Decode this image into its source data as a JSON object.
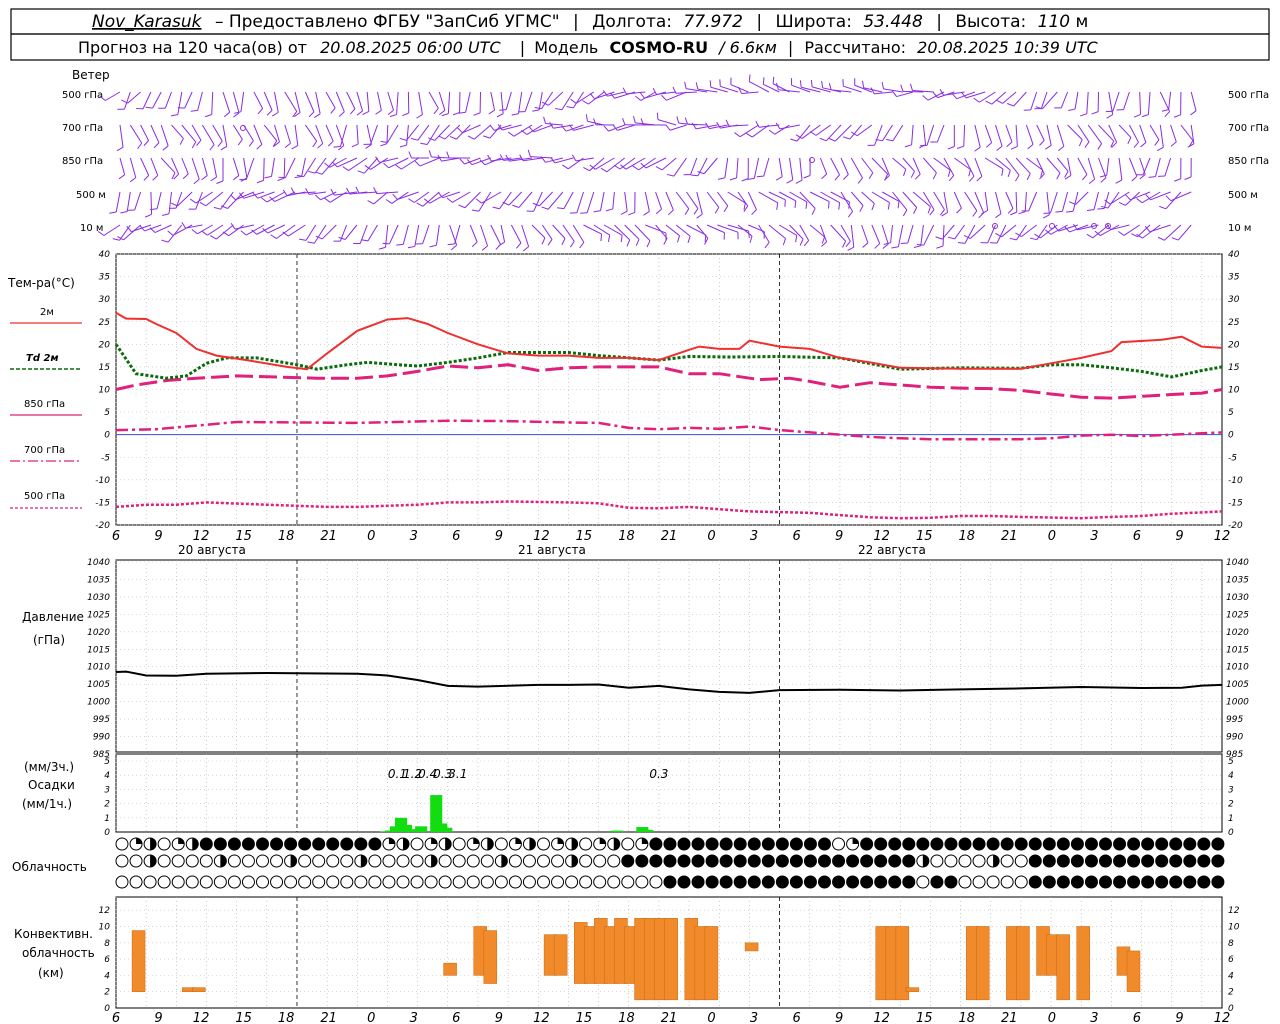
{
  "header": {
    "station": "Nov_Karasuk",
    "provided": "– Предоставлено ФГБУ \"ЗапСиб УГМС\"",
    "lon_label": "Долгота:",
    "lon": "77.972",
    "lat_label": "Широта:",
    "lat": "53.448",
    "alt_label": "Высота:",
    "alt": "110",
    "alt_unit": "м",
    "forecast_prefix": "Прогноз на 120 часа(ов) от",
    "forecast_time": "20.08.2025 06:00 UTC",
    "model_label": "Модель",
    "model_name": "COSMO-RU",
    "model_res": "/ 6.6км",
    "calc_label": "Рассчитано:",
    "calc_time": "20.08.2025 10:39 UTC"
  },
  "colors": {
    "t2m": "#ee3030",
    "td2m": "#0a6b0a",
    "t850": "#e0207a",
    "t700": "#e0207a",
    "t500": "#e0207a",
    "zero_line": "#3050e0",
    "wind": "#8a2be2",
    "precip": "#11dd11",
    "conv": "#f08a2a",
    "pressure": "#000000"
  },
  "axes": {
    "hour_ticks": [
      "6",
      "9",
      "12",
      "15",
      "18",
      "21",
      "0",
      "3",
      "6",
      "9",
      "12",
      "15",
      "18",
      "21",
      "0",
      "3",
      "6",
      "9",
      "12",
      "15",
      "18",
      "21",
      "0",
      "3",
      "6",
      "9",
      "12"
    ],
    "dates": [
      "20 августа",
      "21 августа",
      "22 августа"
    ],
    "temp_ticks": [
      "40",
      "35",
      "30",
      "25",
      "20",
      "15",
      "10",
      "5",
      "0",
      "-5",
      "-10",
      "-15",
      "-20"
    ],
    "pres_ticks": [
      "1040",
      "1035",
      "1030",
      "1025",
      "1020",
      "1015",
      "1010",
      "1005",
      "1000",
      "995",
      "990",
      "985"
    ],
    "precip_ticks": [
      "5",
      "4",
      "3",
      "2",
      "1",
      "0"
    ],
    "conv_ticks": [
      "12",
      "10",
      "8",
      "6",
      "4",
      "2",
      "0"
    ]
  },
  "panels": {
    "wind_title": "Ветер",
    "wind_levels": [
      "500 гПа",
      "700 гПа",
      "850 гПа",
      "500 м",
      "10 м"
    ],
    "temp_title": "Тем-ра(°C)",
    "temp_legend": [
      "2м",
      "Td 2м",
      "850 гПа",
      "700 гПа",
      "500 гПа"
    ],
    "pres_title_1": "Давление",
    "pres_title_2": "(гПа)",
    "precip_title_1": "(мм/3ч.)",
    "precip_title_2": "Осадки",
    "precip_title_3": "(мм/1ч.)",
    "cloud_title": "Облачность",
    "conv_title_1": "Конвективн.",
    "conv_title_2": "облачность",
    "conv_title_3": "(км)"
  },
  "chart_data": {
    "type": "line",
    "x_hours_from_start": "0..30 (20.08 06 UTC — 22.08 12 UTC)",
    "t2m": [
      [
        0,
        27
      ],
      [
        1,
        25.7
      ],
      [
        3,
        25.6
      ],
      [
        4,
        24.5
      ],
      [
        6,
        22.5
      ],
      [
        8,
        19
      ],
      [
        10,
        17.5
      ],
      [
        13,
        16.5
      ],
      [
        17,
        15
      ],
      [
        19,
        14.5
      ],
      [
        21,
        18
      ],
      [
        24,
        23
      ],
      [
        27,
        25.5
      ],
      [
        29,
        25.8
      ],
      [
        31,
        24.5
      ],
      [
        33,
        22.5
      ],
      [
        36,
        20
      ],
      [
        39,
        18
      ],
      [
        42,
        17.5
      ],
      [
        45,
        17.5
      ],
      [
        48,
        17
      ],
      [
        51,
        17
      ],
      [
        54,
        16.5
      ],
      [
        57,
        18.8
      ],
      [
        58,
        19.5
      ],
      [
        60,
        19
      ],
      [
        62,
        19
      ],
      [
        63,
        20.8
      ],
      [
        66,
        19.5
      ],
      [
        69,
        19
      ],
      [
        72,
        17
      ],
      [
        75,
        16
      ],
      [
        78,
        14.8
      ],
      [
        84,
        14.6
      ],
      [
        90,
        14.6
      ],
      [
        93,
        15.8
      ],
      [
        96,
        17
      ],
      [
        99,
        18.5
      ],
      [
        100,
        20.5
      ],
      [
        104,
        21
      ],
      [
        106,
        21.7
      ],
      [
        108,
        19.5
      ],
      [
        110,
        19.2
      ]
    ],
    "td2m": [
      [
        0,
        20
      ],
      [
        2,
        13.5
      ],
      [
        5,
        12.5
      ],
      [
        7,
        13
      ],
      [
        9,
        15.8
      ],
      [
        11,
        17
      ],
      [
        14,
        17
      ],
      [
        18,
        15.5
      ],
      [
        20,
        14.5
      ],
      [
        23,
        15.5
      ],
      [
        25,
        16
      ],
      [
        28,
        15.5
      ],
      [
        30,
        15.2
      ],
      [
        33,
        16
      ],
      [
        36,
        17
      ],
      [
        39,
        18.2
      ],
      [
        45,
        18.2
      ],
      [
        48,
        17.5
      ],
      [
        54,
        16.5
      ],
      [
        57,
        17.3
      ],
      [
        61,
        17.2
      ],
      [
        66,
        17.3
      ],
      [
        72,
        17
      ],
      [
        78,
        14.5
      ],
      [
        84,
        14.8
      ],
      [
        90,
        14.7
      ],
      [
        93,
        15.5
      ],
      [
        96,
        15.5
      ],
      [
        99,
        14.8
      ],
      [
        102,
        14
      ],
      [
        105,
        12.8
      ],
      [
        108,
        14.2
      ],
      [
        110,
        15
      ]
    ],
    "t850": [
      [
        0,
        10
      ],
      [
        2,
        11
      ],
      [
        5,
        12
      ],
      [
        8,
        12.5
      ],
      [
        12,
        13
      ],
      [
        20,
        12.5
      ],
      [
        24,
        12.5
      ],
      [
        27,
        13
      ],
      [
        30,
        14
      ],
      [
        33,
        15.2
      ],
      [
        36,
        14.8
      ],
      [
        39,
        15.5
      ],
      [
        42,
        14.2
      ],
      [
        45,
        14.8
      ],
      [
        48,
        15
      ],
      [
        54,
        15
      ],
      [
        57,
        13.5
      ],
      [
        60,
        13.5
      ],
      [
        64,
        12.2
      ],
      [
        67,
        12.5
      ],
      [
        69,
        11.8
      ],
      [
        72,
        10.5
      ],
      [
        75,
        11.5
      ],
      [
        78,
        11
      ],
      [
        81,
        10.5
      ],
      [
        84,
        10.3
      ],
      [
        87,
        10.2
      ],
      [
        90,
        9.8
      ],
      [
        93,
        9
      ],
      [
        96,
        8.3
      ],
      [
        99,
        8.1
      ],
      [
        102,
        8.5
      ],
      [
        105,
        8.9
      ],
      [
        108,
        9.2
      ],
      [
        110,
        10
      ]
    ],
    "t700": [
      [
        0,
        1
      ],
      [
        4,
        1.2
      ],
      [
        8,
        2
      ],
      [
        12,
        2.8
      ],
      [
        24,
        2.6
      ],
      [
        28,
        2.8
      ],
      [
        33,
        3.1
      ],
      [
        39,
        3
      ],
      [
        45,
        2.7
      ],
      [
        48,
        2.6
      ],
      [
        51,
        1.5
      ],
      [
        54,
        1.2
      ],
      [
        57,
        1.5
      ],
      [
        60,
        1.3
      ],
      [
        63,
        1.8
      ],
      [
        66,
        1
      ],
      [
        69,
        0.5
      ],
      [
        72,
        0
      ],
      [
        75,
        -0.5
      ],
      [
        78,
        -0.8
      ],
      [
        81,
        -1
      ],
      [
        84,
        -1
      ],
      [
        90,
        -1
      ],
      [
        93,
        -0.8
      ],
      [
        96,
        -0.2
      ],
      [
        99,
        0
      ],
      [
        102,
        -0.3
      ],
      [
        105,
        0
      ],
      [
        108,
        0.3
      ],
      [
        110,
        0.5
      ]
    ],
    "t500": [
      [
        0,
        -16
      ],
      [
        3,
        -15.5
      ],
      [
        6,
        -15.5
      ],
      [
        9,
        -15
      ],
      [
        15,
        -15.5
      ],
      [
        21,
        -16
      ],
      [
        24,
        -16
      ],
      [
        30,
        -15.5
      ],
      [
        33,
        -15
      ],
      [
        36,
        -15
      ],
      [
        39,
        -14.8
      ],
      [
        45,
        -15
      ],
      [
        48,
        -15.2
      ],
      [
        51,
        -16.2
      ],
      [
        54,
        -16.3
      ],
      [
        57,
        -16
      ],
      [
        60,
        -16.5
      ],
      [
        63,
        -17
      ],
      [
        69,
        -17.3
      ],
      [
        72,
        -17.8
      ],
      [
        75,
        -18.3
      ],
      [
        78,
        -18.5
      ],
      [
        81,
        -18.4
      ],
      [
        84,
        -18
      ],
      [
        87,
        -18
      ],
      [
        90,
        -18.2
      ],
      [
        96,
        -18.5
      ],
      [
        99,
        -18.2
      ],
      [
        102,
        -18
      ],
      [
        105,
        -17.5
      ],
      [
        108,
        -17.2
      ],
      [
        110,
        -17
      ]
    ],
    "pressure": [
      [
        0,
        1008.5
      ],
      [
        1,
        1008.6
      ],
      [
        3,
        1007.5
      ],
      [
        6,
        1007.4
      ],
      [
        9,
        1008
      ],
      [
        15,
        1008.2
      ],
      [
        24,
        1008
      ],
      [
        27,
        1007.5
      ],
      [
        30,
        1006.2
      ],
      [
        33,
        1004.5
      ],
      [
        36,
        1004.3
      ],
      [
        42,
        1004.8
      ],
      [
        45,
        1004.8
      ],
      [
        48,
        1004.9
      ],
      [
        51,
        1004
      ],
      [
        54,
        1004.5
      ],
      [
        57,
        1003.5
      ],
      [
        60,
        1002.8
      ],
      [
        63,
        1002.5
      ],
      [
        66,
        1003.3
      ],
      [
        72,
        1003.4
      ],
      [
        78,
        1003.2
      ],
      [
        84,
        1003.5
      ],
      [
        90,
        1003.8
      ],
      [
        96,
        1004.2
      ],
      [
        102,
        1003.9
      ],
      [
        106,
        1004
      ],
      [
        108,
        1004.6
      ],
      [
        110,
        1004.8
      ]
    ],
    "precip_labels": [
      [
        "0.1",
        54
      ],
      [
        "1.2",
        57
      ],
      [
        "0.4",
        60
      ],
      [
        "0.3",
        63
      ],
      [
        "3.1",
        66
      ],
      [
        "0.3",
        106
      ]
    ],
    "precip_1h": [
      [
        53,
        0.05
      ],
      [
        54,
        0.1
      ],
      [
        55,
        0.4
      ],
      [
        56,
        1
      ],
      [
        57,
        0.5
      ],
      [
        58,
        0.2
      ],
      [
        60,
        0.4
      ],
      [
        63,
        2.6
      ],
      [
        64,
        0.6
      ],
      [
        65,
        0.3
      ],
      [
        99,
        0.1
      ],
      [
        104,
        0.35
      ],
      [
        105,
        0.15
      ]
    ],
    "convective": [
      [
        1,
        2,
        9.5
      ],
      [
        6,
        2,
        2.5
      ],
      [
        7,
        2,
        2.5
      ],
      [
        32,
        4,
        5.5
      ],
      [
        35,
        4,
        10
      ],
      [
        36,
        3,
        9.5
      ],
      [
        42,
        4,
        9
      ],
      [
        43,
        4,
        9
      ],
      [
        45,
        3,
        10.5
      ],
      [
        46,
        3,
        10
      ],
      [
        47,
        3,
        11
      ],
      [
        48,
        3,
        10
      ],
      [
        49,
        3,
        11
      ],
      [
        50,
        3,
        10
      ],
      [
        51,
        1,
        11
      ],
      [
        52,
        1,
        11
      ],
      [
        53,
        1,
        11
      ],
      [
        54,
        1,
        11
      ],
      [
        55,
        2,
        2
      ],
      [
        56,
        1,
        11
      ],
      [
        57,
        1,
        10
      ],
      [
        58,
        1,
        10
      ],
      [
        62,
        7,
        8
      ],
      [
        75,
        1,
        10
      ],
      [
        76,
        1,
        10
      ],
      [
        77,
        1,
        10
      ],
      [
        78,
        2,
        2.5
      ],
      [
        84,
        1,
        10
      ],
      [
        85,
        1,
        10
      ],
      [
        88,
        1,
        10
      ],
      [
        89,
        1,
        10
      ],
      [
        91,
        4,
        10
      ],
      [
        92,
        4,
        9
      ],
      [
        93,
        1,
        9
      ],
      [
        95,
        1,
        10
      ],
      [
        99,
        4,
        7.5
      ],
      [
        100,
        2,
        7
      ]
    ]
  }
}
